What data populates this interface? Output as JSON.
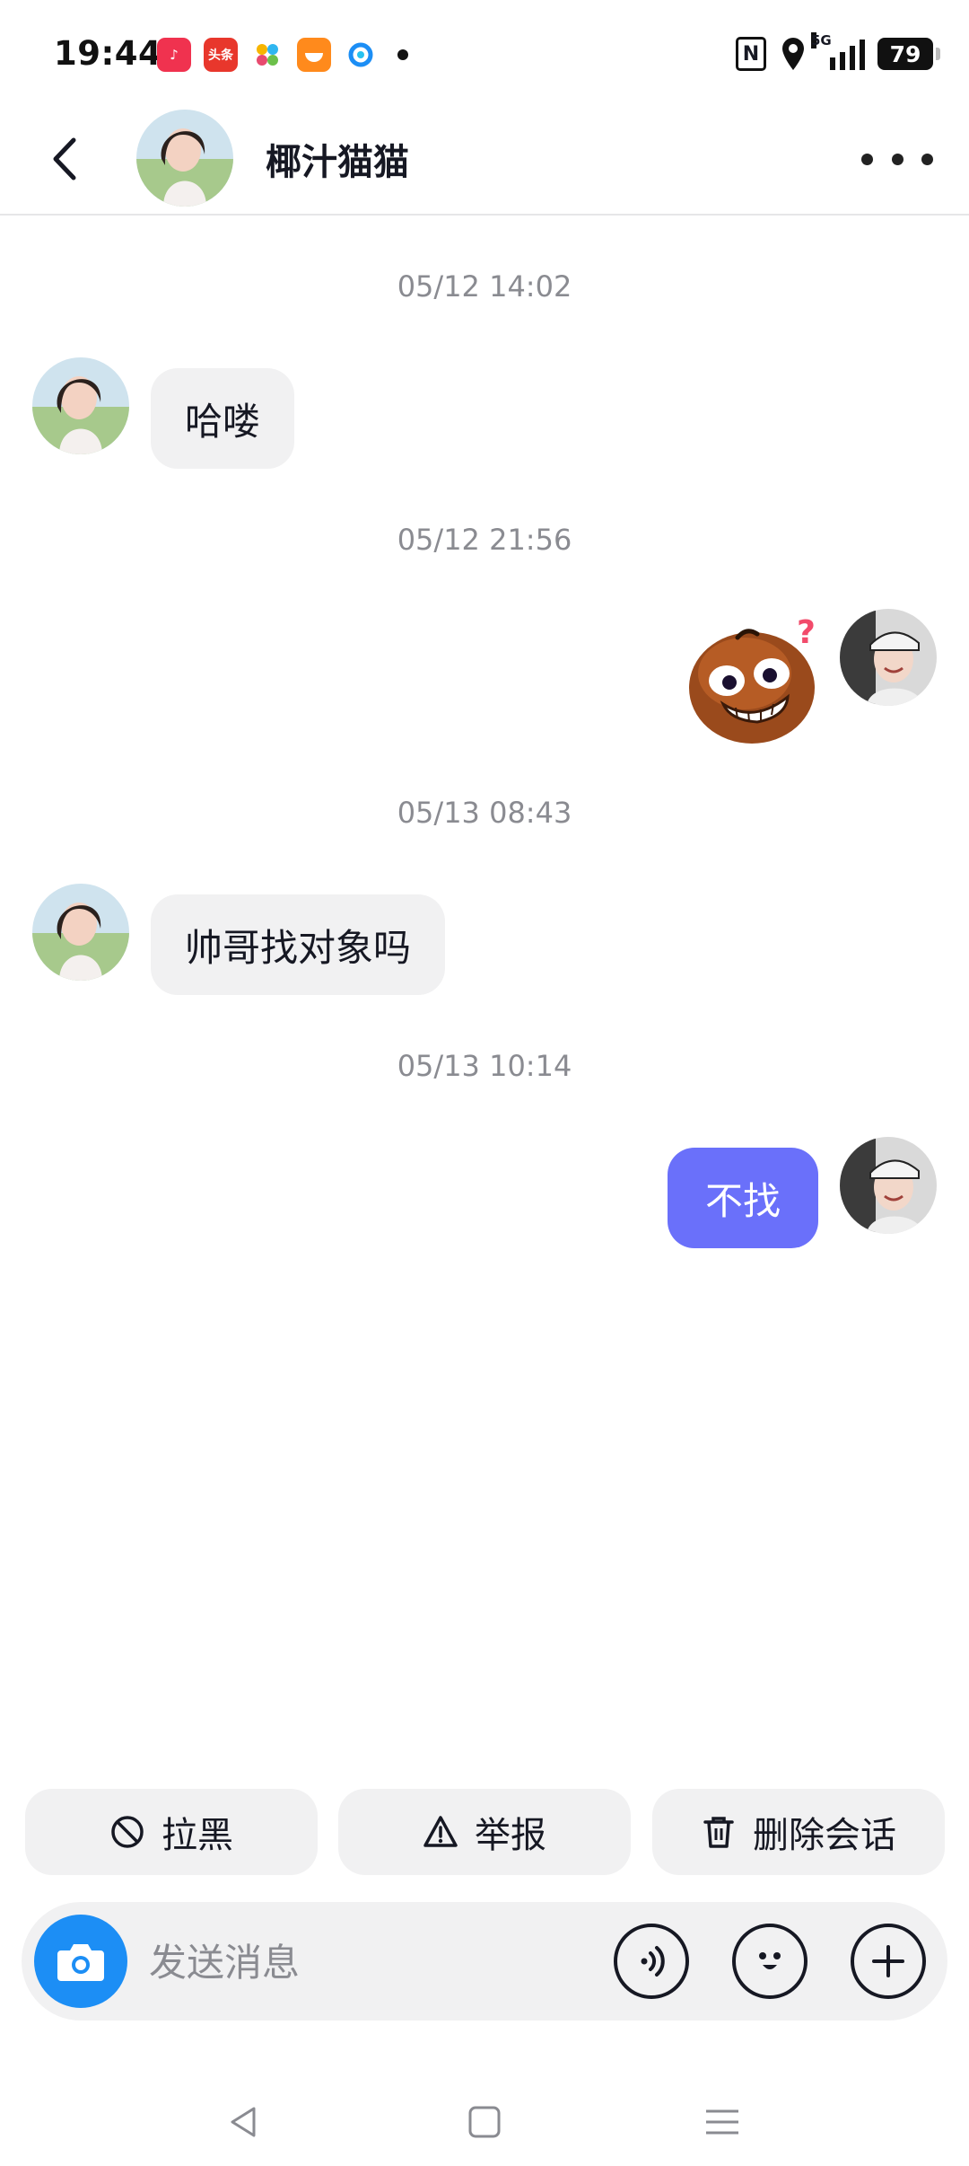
{
  "status_bar": {
    "time": "19:44",
    "apps": [
      "music-app-icon",
      "toutiao-app-icon",
      "colorful-app-icon",
      "food-app-icon",
      "browser-app-icon"
    ],
    "toutiao_label": "头条",
    "network": "5G",
    "battery": "79"
  },
  "header": {
    "contact_name": "椰汁猫猫",
    "back_icon": "chevron-left-icon",
    "more_icon": "more-dots-icon"
  },
  "messages": [
    {
      "type": "timestamp",
      "text": "05/12 14:02"
    },
    {
      "type": "text",
      "direction": "incoming",
      "text": "哈喽"
    },
    {
      "type": "timestamp",
      "text": "05/12 21:56"
    },
    {
      "type": "sticker",
      "direction": "outgoing",
      "sticker": "confused-grin-emoji-sticker"
    },
    {
      "type": "timestamp",
      "text": "05/13 08:43"
    },
    {
      "type": "text",
      "direction": "incoming",
      "text": "帅哥找对象吗"
    },
    {
      "type": "timestamp",
      "text": "05/13 10:14"
    },
    {
      "type": "text",
      "direction": "outgoing",
      "text": "不找"
    }
  ],
  "actions": {
    "block": {
      "label": "拉黑",
      "icon": "block-icon"
    },
    "report": {
      "label": "举报",
      "icon": "warning-icon"
    },
    "delete": {
      "label": "删除会话",
      "icon": "trash-icon"
    }
  },
  "input": {
    "placeholder": "发送消息",
    "camera_icon": "camera-icon",
    "voice_icon": "voice-icon",
    "emoji_icon": "emoji-icon",
    "plus_icon": "plus-icon"
  },
  "colors": {
    "outgoing_bubble": "#6a70fa",
    "incoming_bubble": "#f1f1f2",
    "camera_button": "#1c8ef5",
    "timestamp": "#8a8b91"
  }
}
